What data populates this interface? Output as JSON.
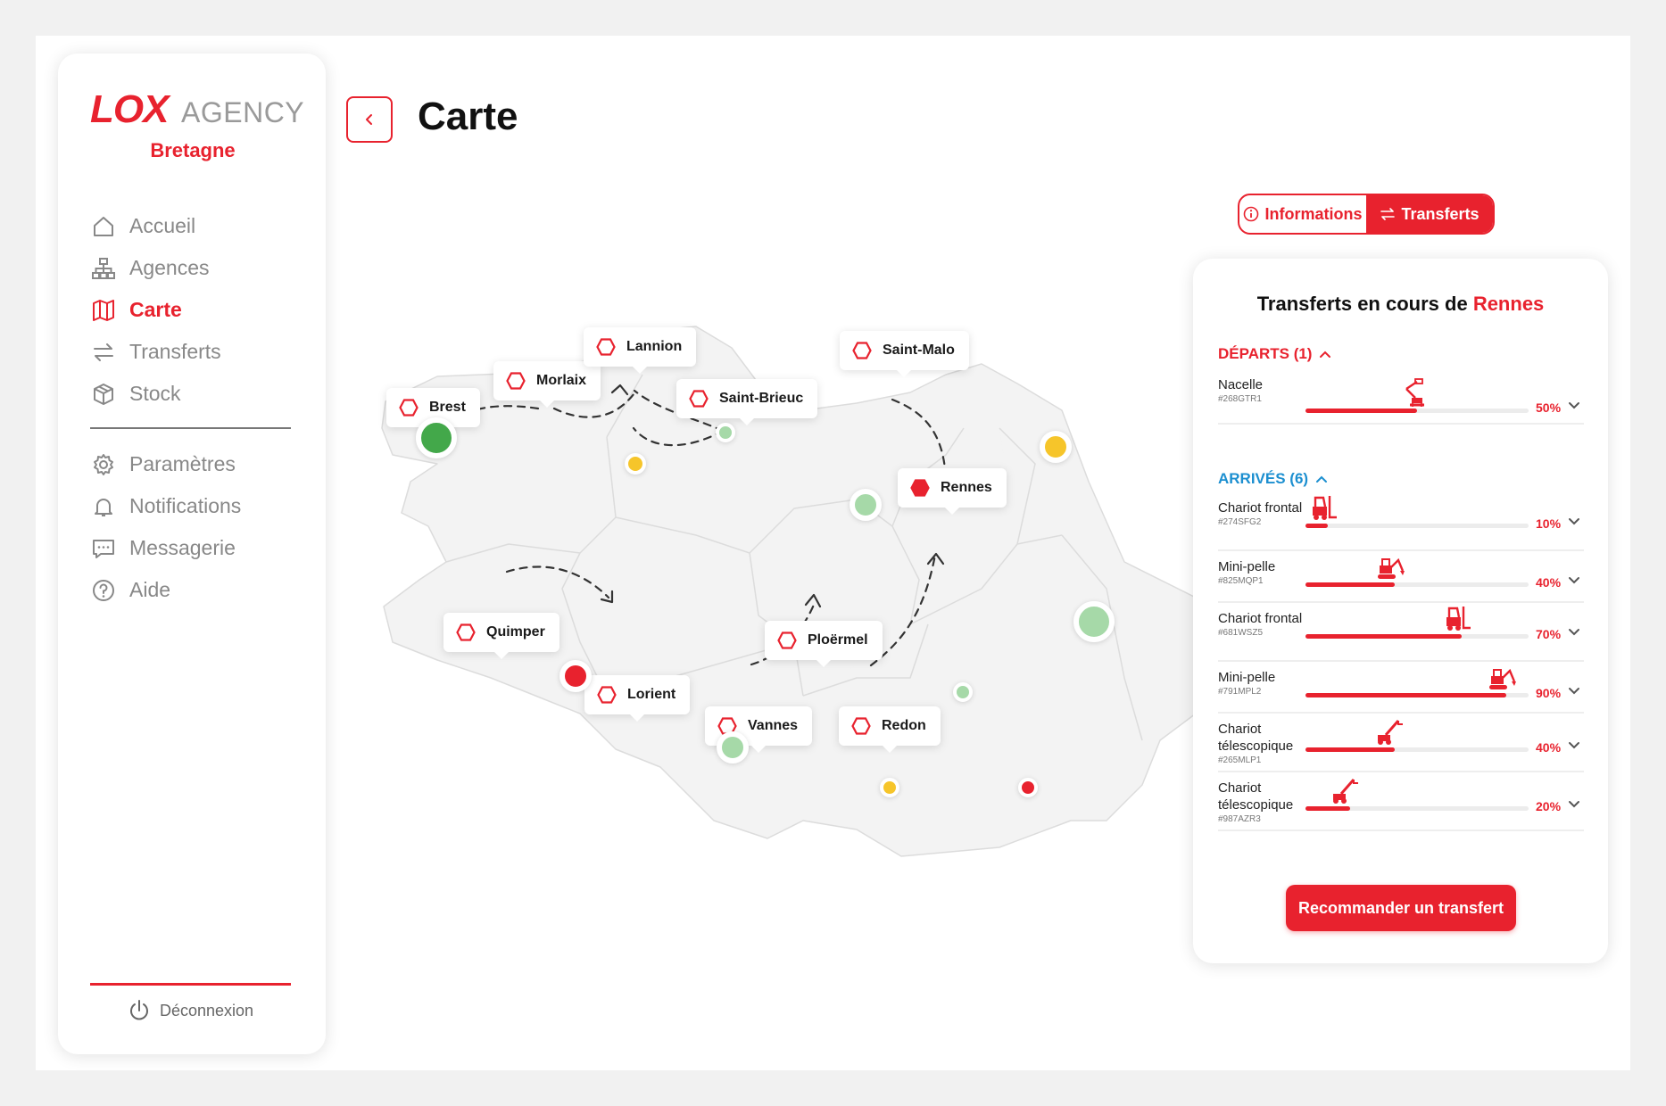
{
  "brand": {
    "logo_main": "LOX",
    "logo_sub": "AGENCY",
    "region": "Bretagne",
    "accent": "#e8222e",
    "secondary": "#1c8fd0"
  },
  "sidebar": {
    "items": [
      {
        "label": "Accueil",
        "icon": "home-icon"
      },
      {
        "label": "Agences",
        "icon": "network-icon"
      },
      {
        "label": "Carte",
        "icon": "map-icon",
        "active": true
      },
      {
        "label": "Transferts",
        "icon": "swap-icon"
      },
      {
        "label": "Stock",
        "icon": "box-icon"
      }
    ],
    "items2": [
      {
        "label": "Paramètres",
        "icon": "gear-icon"
      },
      {
        "label": "Notifications",
        "icon": "bell-icon"
      },
      {
        "label": "Messagerie",
        "icon": "message-icon"
      },
      {
        "label": "Aide",
        "icon": "help-icon"
      }
    ],
    "logout": "Déconnexion"
  },
  "header": {
    "title": "Carte"
  },
  "toggle": {
    "informations": "Informations",
    "transferts": "Transferts",
    "active": "Transferts"
  },
  "map": {
    "cities": [
      {
        "name": "Brest",
        "status": "green"
      },
      {
        "name": "Morlaix",
        "status": "yellow"
      },
      {
        "name": "Lannion",
        "status": "light-green"
      },
      {
        "name": "Saint-Brieuc",
        "status": "light-green"
      },
      {
        "name": "Saint-Malo",
        "status": "yellow"
      },
      {
        "name": "Rennes",
        "status": "light-green",
        "selected": true
      },
      {
        "name": "Quimper",
        "status": "red"
      },
      {
        "name": "Lorient",
        "status": "light-green"
      },
      {
        "name": "Vannes",
        "status": "yellow"
      },
      {
        "name": "Ploërmel",
        "status": "light-green"
      },
      {
        "name": "Redon",
        "status": "red"
      }
    ]
  },
  "panel": {
    "title_prefix": "Transferts en cours de",
    "title_city": "Rennes",
    "departures_label": "DÉPARTS (1)",
    "arrivals_label": "ARRIVÉS (6)",
    "departures": [
      {
        "name": "Nacelle",
        "code": "#268GTR1",
        "progress": 50,
        "pct": "50%",
        "machine": "boom-lift-icon"
      }
    ],
    "arrivals": [
      {
        "name": "Chariot frontal",
        "code": "#274SFG2",
        "progress": 10,
        "pct": "10%",
        "machine": "forklift-icon"
      },
      {
        "name": "Mini-pelle",
        "code": "#825MQP1",
        "progress": 40,
        "pct": "40%",
        "machine": "mini-excavator-icon"
      },
      {
        "name": "Chariot frontal",
        "code": "#681WSZ5",
        "progress": 70,
        "pct": "70%",
        "machine": "forklift-icon"
      },
      {
        "name": "Mini-pelle",
        "code": "#791MPL2",
        "progress": 90,
        "pct": "90%",
        "machine": "mini-excavator-icon"
      },
      {
        "name": "Chariot télescopique",
        "code": "#265MLP1",
        "progress": 40,
        "pct": "40%",
        "machine": "telehandler-icon"
      },
      {
        "name": "Chariot télescopique",
        "code": "#987AZR3",
        "progress": 20,
        "pct": "20%",
        "machine": "telehandler-icon"
      }
    ],
    "button": "Recommander un transfert"
  }
}
